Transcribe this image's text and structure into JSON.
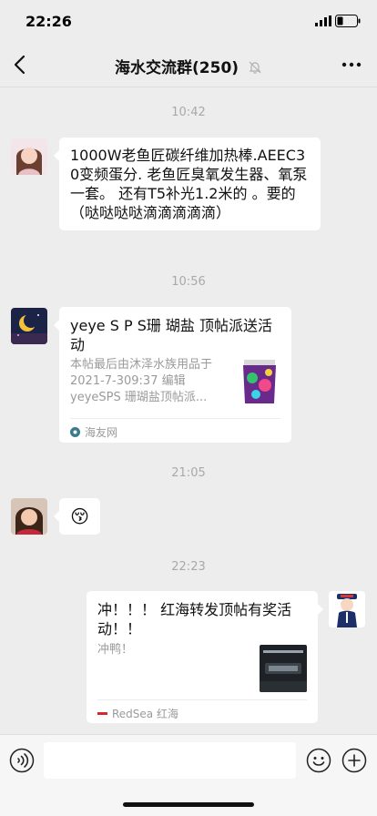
{
  "status_bar": {
    "time": "22:26"
  },
  "header": {
    "title": "海水交流群(250)"
  },
  "messages": [
    {
      "timestamp": "10:42",
      "text": "1000W老鱼匠碳纤维加热棒.AEEC30变频蛋分. 老鱼匠臭氧发生器、氧泵一套。 还有T5补光1.2米的 。要的（哒哒哒哒滴滴滴滴滴）"
    },
    {
      "timestamp": "10:56",
      "card_title": "yeye S P S珊 瑚盐 顶帖派送活动",
      "card_desc": "本帖最后由沐泽水族用品于 2021-7-309:37 编辑 yeyeSPS 珊瑚盐顶帖派...",
      "card_source": "海友网"
    },
    {
      "timestamp": "21:05",
      "emoji": "😚"
    },
    {
      "timestamp": "22:23",
      "card_title": "冲！！！ 红海转发顶帖有奖活动！！",
      "card_desc": "冲鸭！",
      "card_source": "RedSea 红海"
    }
  ],
  "input": {
    "value": "",
    "placeholder": ""
  },
  "colors": {
    "background": "#ededed",
    "bubble": "#ffffff",
    "meta_text": "#a9a9a9"
  }
}
